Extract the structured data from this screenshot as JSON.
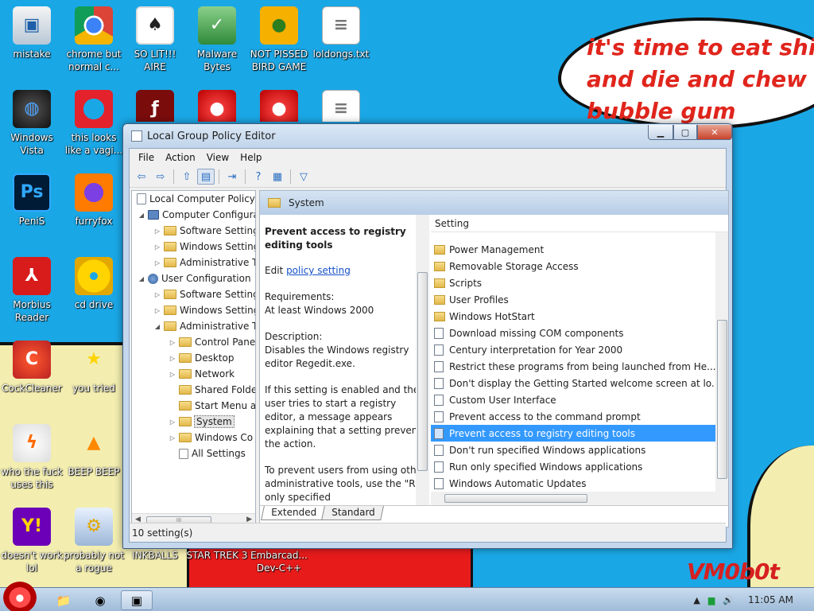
{
  "desktop": {
    "speech_bubble": "it's time to eat shit\nand die and chew\nbubble gum",
    "watermark": "VM0b0t",
    "icons": [
      {
        "label": "mistake",
        "icon": "computer-icon"
      },
      {
        "label": "chrome but normal c...",
        "icon": "chrome-icon"
      },
      {
        "label": "SO LIT!!! AIRE",
        "icon": "playing-cards-icon"
      },
      {
        "label": "Malware Bytes",
        "icon": "shield-icon"
      },
      {
        "label": "NOT PISSED BIRD GAME",
        "icon": "pig-icon"
      },
      {
        "label": "loldongs.txt",
        "icon": "text-file-icon"
      },
      {
        "label": "Windows Vista",
        "icon": "vista-icon"
      },
      {
        "label": "this looks like a vagi...",
        "icon": "opera-icon"
      },
      {
        "label": "PeniS",
        "icon": "photoshop-icon"
      },
      {
        "label": "furryfox",
        "icon": "firefox-icon"
      },
      {
        "label": "Morbius Reader",
        "icon": "pdf-icon"
      },
      {
        "label": "cd drive",
        "icon": "cd-icon"
      },
      {
        "label": "CockCleaner",
        "icon": "ccleaner-icon"
      },
      {
        "label": "you tried",
        "icon": "star-icon"
      },
      {
        "label": "who the fuck uses this",
        "icon": "lightning-icon"
      },
      {
        "label": "BEEP BEEP",
        "icon": "vlc-cone-icon"
      },
      {
        "label": "doesn't work lol",
        "icon": "yahoo-icon"
      },
      {
        "label": "probably not a rogue",
        "icon": "gears-icon"
      },
      {
        "label": "INKBALLS",
        "icon": ""
      },
      {
        "label": "STAR TREK 3",
        "icon": ""
      },
      {
        "label": "Embarcad... Dev-C++",
        "icon": ""
      }
    ]
  },
  "window": {
    "title": "Local Group Policy Editor",
    "controls": {
      "minimize": "▁",
      "maximize": "▢",
      "close": "✕"
    },
    "menu": [
      "File",
      "Action",
      "View",
      "Help"
    ],
    "toolbar": [
      {
        "name": "back-icon",
        "glyph": "⇦"
      },
      {
        "name": "forward-icon",
        "glyph": "⇨"
      },
      {
        "name": "up-folder-icon",
        "glyph": "⇧"
      },
      {
        "name": "show-hide-tree-icon",
        "glyph": "▤"
      },
      {
        "name": "export-list-icon",
        "glyph": "⇥"
      },
      {
        "name": "help-icon",
        "glyph": "?"
      },
      {
        "name": "properties-icon",
        "glyph": "▦"
      },
      {
        "name": "filter-icon",
        "glyph": "▽"
      }
    ],
    "tree": [
      {
        "label": "Local Computer Policy",
        "level": 0,
        "expander": "",
        "icon": "doc"
      },
      {
        "label": "Computer Configura",
        "level": 1,
        "expander": "◢",
        "icon": "pc"
      },
      {
        "label": "Software Setting",
        "level": 2,
        "expander": "▷",
        "icon": "folder"
      },
      {
        "label": "Windows Setting",
        "level": 2,
        "expander": "▷",
        "icon": "folder"
      },
      {
        "label": "Administrative Te",
        "level": 2,
        "expander": "▷",
        "icon": "folder"
      },
      {
        "label": "User Configuration",
        "level": 1,
        "expander": "◢",
        "icon": "user"
      },
      {
        "label": "Software Setting",
        "level": 2,
        "expander": "▷",
        "icon": "folder"
      },
      {
        "label": "Windows Setting",
        "level": 2,
        "expander": "▷",
        "icon": "folder"
      },
      {
        "label": "Administrative Te",
        "level": 2,
        "expander": "◢",
        "icon": "folder"
      },
      {
        "label": "Control Pane",
        "level": 3,
        "expander": "▷",
        "icon": "folder"
      },
      {
        "label": "Desktop",
        "level": 3,
        "expander": "▷",
        "icon": "folder"
      },
      {
        "label": "Network",
        "level": 3,
        "expander": "▷",
        "icon": "folder"
      },
      {
        "label": "Shared Folde",
        "level": 3,
        "expander": "",
        "icon": "folder"
      },
      {
        "label": "Start Menu ar",
        "level": 3,
        "expander": "",
        "icon": "folder"
      },
      {
        "label": "System",
        "level": 3,
        "expander": "▷",
        "icon": "folder",
        "selected": true
      },
      {
        "label": "Windows Co",
        "level": 3,
        "expander": "▷",
        "icon": "folder"
      },
      {
        "label": "All Settings",
        "level": 3,
        "expander": "",
        "icon": "set"
      }
    ],
    "header": {
      "title": "System"
    },
    "description": {
      "title": "Prevent access to registry editing tools",
      "edit_prefix": "Edit ",
      "edit_link": "policy setting",
      "requirements": "Requirements:\nAt least Windows 2000",
      "description": "Description:\nDisables the Windows registry editor Regedit.exe.",
      "if_enabled": "If this setting is enabled and the user tries to start a registry editor, a message appears explaining that a setting prevents the action.",
      "to_prevent": "To prevent users from using other administrative tools, use the \"Run only specified"
    },
    "list": {
      "column": "Setting",
      "rows": [
        {
          "label": "Power Management",
          "type": "folder"
        },
        {
          "label": "Removable Storage Access",
          "type": "folder"
        },
        {
          "label": "Scripts",
          "type": "folder"
        },
        {
          "label": "User Profiles",
          "type": "folder"
        },
        {
          "label": "Windows HotStart",
          "type": "folder"
        },
        {
          "label": "Download missing COM components",
          "type": "setting"
        },
        {
          "label": "Century interpretation for Year 2000",
          "type": "setting"
        },
        {
          "label": "Restrict these programs from being launched from He...",
          "type": "setting"
        },
        {
          "label": "Don't display the Getting Started welcome screen at lo...",
          "type": "setting"
        },
        {
          "label": "Custom User Interface",
          "type": "setting"
        },
        {
          "label": "Prevent access to the command prompt",
          "type": "setting"
        },
        {
          "label": "Prevent access to registry editing tools",
          "type": "setting",
          "selected": true
        },
        {
          "label": "Don't run specified Windows applications",
          "type": "setting"
        },
        {
          "label": "Run only specified Windows applications",
          "type": "setting"
        },
        {
          "label": "Windows Automatic Updates",
          "type": "setting"
        }
      ]
    },
    "tabs": [
      "Extended",
      "Standard"
    ],
    "status": "10 setting(s)"
  },
  "taskbar": {
    "clock": "11:05 AM",
    "tray_up": "▲"
  },
  "colors": {
    "desktop_bg": "#1aa7e6",
    "selection": "#3399ff",
    "speech_text": "#e0251c"
  }
}
